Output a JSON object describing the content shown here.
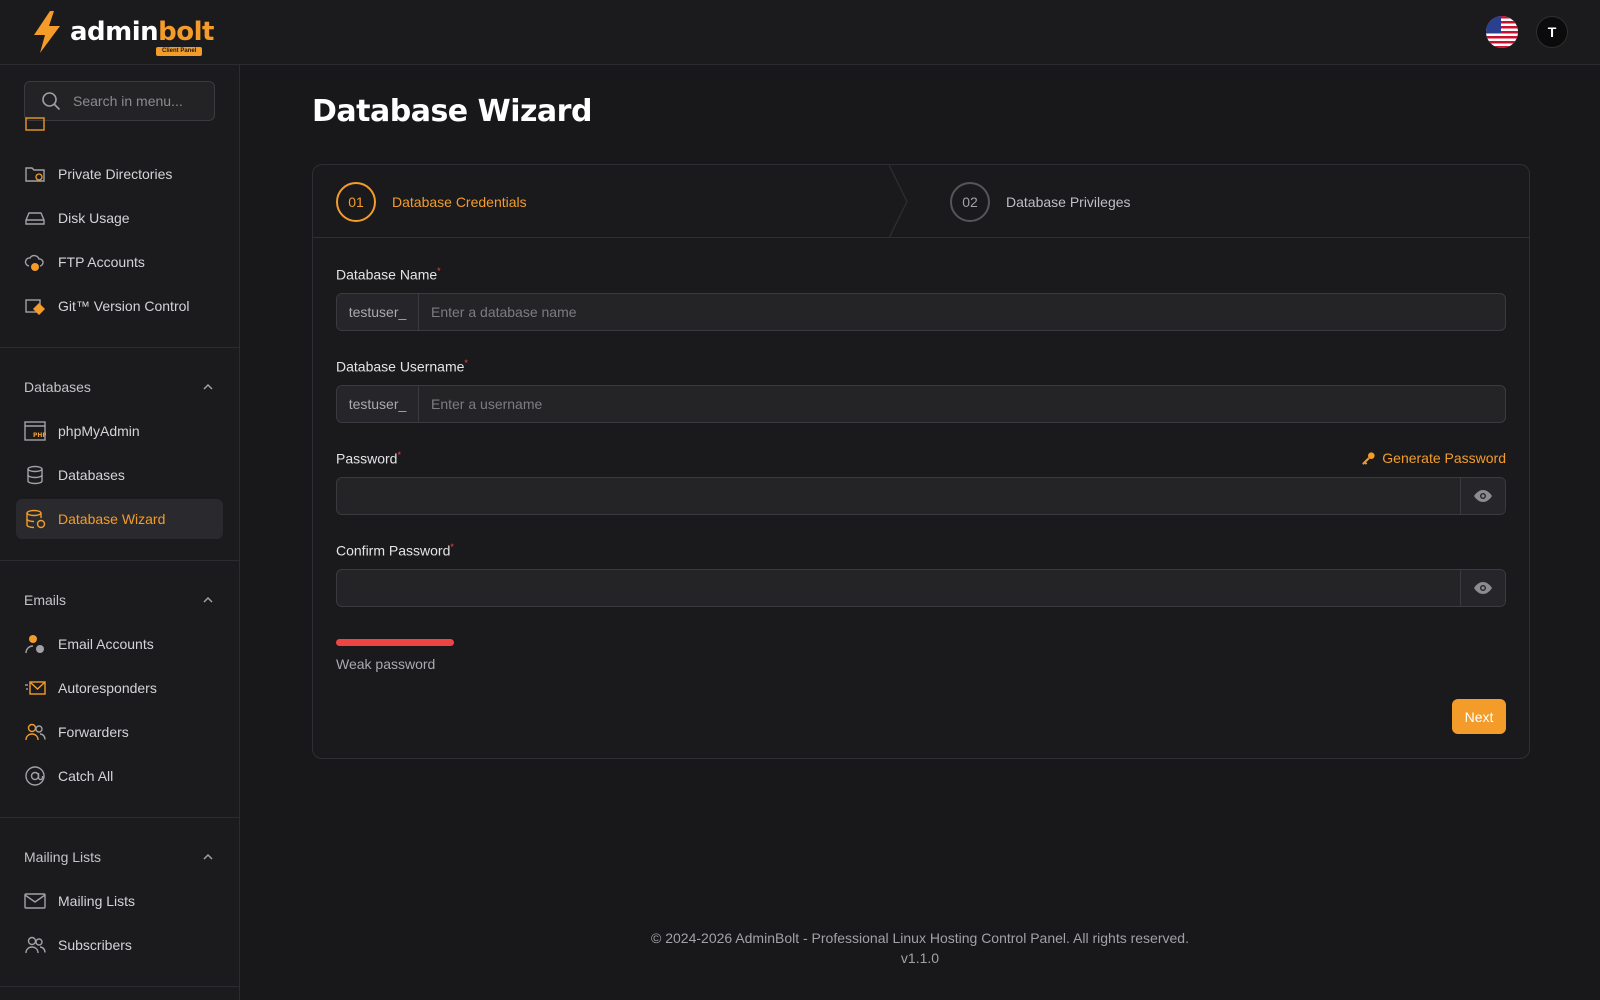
{
  "brand": {
    "name_white": "admin",
    "name_orange": "bolt",
    "badge": "Client Panel"
  },
  "header": {
    "avatar_initial": "T"
  },
  "search": {
    "placeholder": "Search in menu..."
  },
  "sidebar": {
    "top_items": [
      {
        "label": "Private Directories",
        "icon": "folder-lock-icon"
      },
      {
        "label": "Disk Usage",
        "icon": "hard-drive-icon"
      },
      {
        "label": "FTP Accounts",
        "icon": "ftp-cloud-icon"
      },
      {
        "label": "Git™ Version Control",
        "icon": "git-icon"
      }
    ],
    "sections": [
      {
        "title": "Databases",
        "items": [
          {
            "label": "phpMyAdmin",
            "icon": "php-window-icon"
          },
          {
            "label": "Databases",
            "icon": "database-icon"
          },
          {
            "label": "Database Wizard",
            "icon": "database-wizard-icon",
            "active": true
          }
        ]
      },
      {
        "title": "Emails",
        "items": [
          {
            "label": "Email Accounts",
            "icon": "email-user-icon"
          },
          {
            "label": "Autoresponders",
            "icon": "autoresponder-icon"
          },
          {
            "label": "Forwarders",
            "icon": "forwarders-icon"
          },
          {
            "label": "Catch All",
            "icon": "at-sign-icon"
          }
        ]
      },
      {
        "title": "Mailing Lists",
        "items": [
          {
            "label": "Mailing Lists",
            "icon": "envelope-icon"
          },
          {
            "label": "Subscribers",
            "icon": "subscribers-icon"
          }
        ]
      }
    ]
  },
  "page": {
    "title": "Database Wizard"
  },
  "steps": [
    {
      "number": "01",
      "label": "Database Credentials",
      "active": true
    },
    {
      "number": "02",
      "label": "Database Privileges",
      "active": false
    }
  ],
  "form": {
    "db_name": {
      "label": "Database Name",
      "required": "*",
      "prefix": "testuser_",
      "placeholder": "Enter a database name",
      "value": ""
    },
    "db_user": {
      "label": "Database Username",
      "required": "*",
      "prefix": "testuser_",
      "placeholder": "Enter a username",
      "value": ""
    },
    "password": {
      "label": "Password",
      "required": "*",
      "value": ""
    },
    "confirm_password": {
      "label": "Confirm Password",
      "required": "*",
      "value": ""
    },
    "generate_label": "Generate Password",
    "strength": {
      "text": "Weak password",
      "level": 0.25,
      "color": "#ef4444"
    },
    "next_label": "Next"
  },
  "footer": {
    "copyright": "© 2024-2026 AdminBolt - Professional Linux Hosting Control Panel. All rights reserved.",
    "version": "v1.1.0"
  },
  "colors": {
    "accent": "#f39c2a",
    "background": "#18181b",
    "danger": "#ef4444"
  }
}
